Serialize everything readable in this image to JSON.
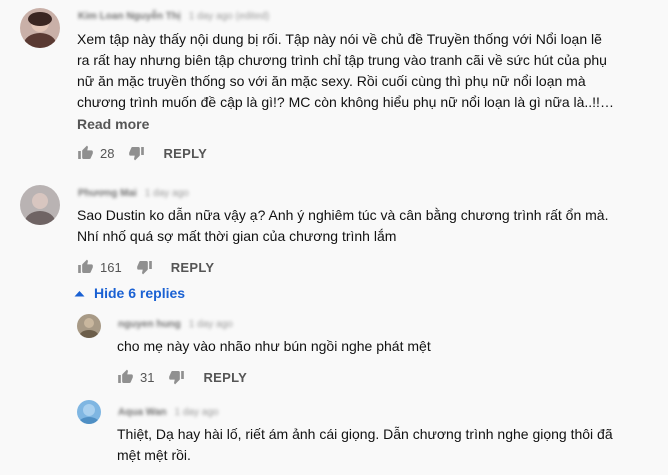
{
  "comments": [
    {
      "author": "Kim Loan Nguyễn Thị",
      "time": "1 day ago (edited)",
      "text": "Xem tập này thấy nội dung bị rối. Tập này nói về chủ đề Truyền thống với Nổi loạn lẽ\nra rất hay nhưng biên tập chương trình chỉ tập trung vào tranh cãi về sức hút của phụ\nnữ ăn mặc truyền thống so với ăn mặc sexy. Rồi cuối cùng thì phụ nữ nổi loạn mà\nchương trình muốn đề cập là gì!? MC còn không hiểu phụ nữ nổi loạn là gì nữa là..!!…",
      "read_more": "Read more",
      "likes": "28",
      "reply_label": "REPLY"
    },
    {
      "author": "Phương Mai",
      "time": "1 day ago",
      "text": "Sao Dustin ko dẫn nữa vậy ạ? Anh ý nghiêm túc và cân bằng chương trình rất ổn mà.\nNhí nhố quá sợ mất thời gian của chương trình lắm",
      "likes": "161",
      "reply_label": "REPLY"
    }
  ],
  "replies_toggle": {
    "label": "Hide 6 replies"
  },
  "replies": [
    {
      "author": "nguyen hung",
      "time": "1 day ago",
      "text": "cho mẹ này vào nhão như bún ngồi nghe phát mệt",
      "likes": "31",
      "reply_label": "REPLY"
    },
    {
      "author": "Aqua Wan",
      "time": "1 day ago",
      "text": "Thiệt, Dạ hay hài lố, riết ám ảnh cái giọng. Dẫn chương trình nghe giọng thôi đã\nmệt mệt rồi."
    }
  ],
  "colors": {
    "background": "#f9f9f9",
    "link_blue": "#1a61d3",
    "icon_grey": "#909090"
  }
}
